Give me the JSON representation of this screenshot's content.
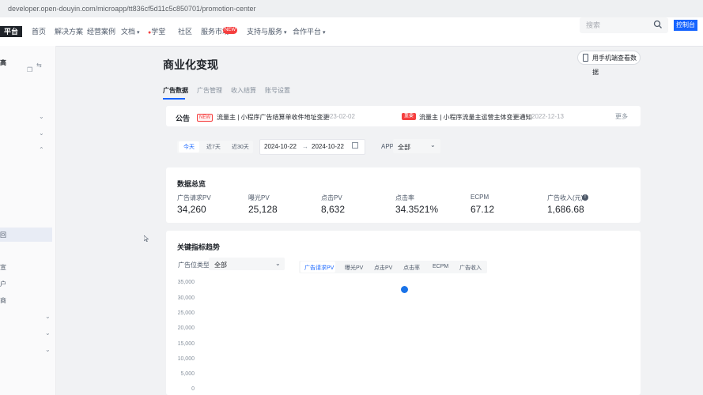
{
  "browser": {
    "url": "developer.open-douyin.com/microapp/tt836cf5d11c5c850701/promotion-center"
  },
  "topnav": {
    "logo": "平台",
    "items": [
      "首页",
      "解决方案",
      "经营案例",
      "文档",
      "学堂",
      "社区",
      "服务市场",
      "支持与服务",
      "合作平台"
    ],
    "hot_badge": "NEW",
    "search_placeholder": "搜索",
    "console": "控制台"
  },
  "sidebar": {
    "items": [
      "高",
      "回",
      "宣",
      "户",
      "商",
      "服"
    ],
    "active_item": "回"
  },
  "page": {
    "title": "商业化变现",
    "mobile_button": "用手机端查看数据",
    "tabs": [
      {
        "label": "广告数据",
        "active": true
      },
      {
        "label": "广告管理",
        "active": false
      },
      {
        "label": "收入结算",
        "active": false
      },
      {
        "label": "账号设置",
        "active": false
      }
    ]
  },
  "notice": {
    "label": "公告",
    "badge_new": "NEW",
    "item1_text": "流量主 | 小程序广告结算单收件地址变更",
    "item1_date": "2023-02-02",
    "badge_important": "重要",
    "item2_text": "流量主 | 小程序流量主运营主体变更通知",
    "item2_date": "2022-12-13",
    "more": "更多"
  },
  "filters": {
    "ranges": [
      "今天",
      "近7天",
      "近30天"
    ],
    "active_range": "今天",
    "date_start": "2024-10-22",
    "date_sep": "→",
    "date_end": "2024-10-22",
    "app_label": "APP",
    "app_value": "全部"
  },
  "overview": {
    "title": "数据总览",
    "metrics": [
      {
        "label": "广告请求PV",
        "value": "34,260"
      },
      {
        "label": "曝光PV",
        "value": "25,128"
      },
      {
        "label": "点击PV",
        "value": "8,632"
      },
      {
        "label": "点击率",
        "value": "34.3521%"
      },
      {
        "label": "ECPM",
        "value": "67.12"
      },
      {
        "label": "广告收入(元)",
        "value": "1,686.68"
      }
    ]
  },
  "trend": {
    "title": "关键指标趋势",
    "filter_label": "广告位类型",
    "filter_value": "全部",
    "metric_tabs": [
      "广告请求PV",
      "曝光PV",
      "点击PV",
      "点击率",
      "ECPM",
      "广告收入"
    ],
    "active_metric": "广告请求PV",
    "y_ticks": [
      "35,000",
      "30,000",
      "25,000",
      "20,000",
      "15,000",
      "10,000",
      "5,000",
      "0"
    ]
  },
  "colors": {
    "accent": "#1664ff",
    "danger": "#f53f3f"
  }
}
